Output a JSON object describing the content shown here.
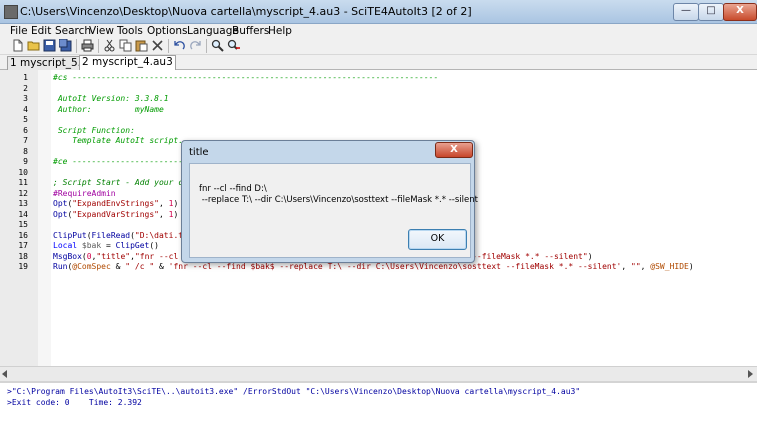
{
  "window": {
    "title": "C:\\Users\\Vincenzo\\Desktop\\Nuova cartella\\myscript_4.au3 - SciTE4AutoIt3 [2 of 2]",
    "minimize": "—",
    "maximize": "□",
    "close": "X",
    "icon": "scite-app-icon"
  },
  "menu": [
    "File",
    "Edit",
    "Search",
    "View",
    "Tools",
    "Options",
    "Language",
    "Buffers",
    "Help"
  ],
  "toolbar": {
    "icons": [
      "new-file-icon",
      "open-folder-icon",
      "save-icon",
      "save-all-icon",
      "print-icon",
      "cut-icon",
      "copy-icon",
      "paste-icon",
      "delete-icon",
      "undo-icon",
      "redo-icon",
      "find-icon",
      "find-replace-icon"
    ]
  },
  "tabs": [
    {
      "label": "1 myscript_5.au3",
      "active": false
    },
    {
      "label": "2 myscript_4.au3",
      "active": true
    }
  ],
  "editor": {
    "line_numbers": [
      "1",
      "2",
      "3",
      "4",
      "5",
      "6",
      "7",
      "8",
      "9",
      "10",
      "11",
      "12",
      "13",
      "14",
      "15",
      "16",
      "17",
      "18",
      "19"
    ],
    "lines": [
      [
        {
          "t": "#cs ----------------------------------------------------------------------------",
          "c": "c-blk"
        }
      ],
      [
        {
          "t": "",
          "c": "c-plain"
        }
      ],
      [
        {
          "t": " AutoIt Version: 3.3.8.1",
          "c": "c-blk"
        }
      ],
      [
        {
          "t": " Author:         myName",
          "c": "c-blk"
        }
      ],
      [
        {
          "t": "",
          "c": "c-plain"
        }
      ],
      [
        {
          "t": " Script Function:",
          "c": "c-blk"
        }
      ],
      [
        {
          "t": "    Template AutoIt script.",
          "c": "c-blk"
        }
      ],
      [
        {
          "t": "",
          "c": "c-plain"
        }
      ],
      [
        {
          "t": "#ce ----------------------------------------------------------------------------",
          "c": "c-blk"
        }
      ],
      [
        {
          "t": "",
          "c": "c-plain"
        }
      ],
      [
        {
          "t": "; Script Start - Add your code below here",
          "c": "c-com"
        }
      ],
      [
        {
          "t": "#RequireAdmin",
          "c": "c-dir"
        }
      ],
      [
        {
          "t": "Opt",
          "c": "c-fn"
        },
        {
          "t": "(",
          "c": "c-plain"
        },
        {
          "t": "\"ExpandEnvStrings\"",
          "c": "c-str"
        },
        {
          "t": ", ",
          "c": "c-plain"
        },
        {
          "t": "1",
          "c": "c-num"
        },
        {
          "t": ")",
          "c": "c-plain"
        }
      ],
      [
        {
          "t": "Opt",
          "c": "c-fn"
        },
        {
          "t": "(",
          "c": "c-plain"
        },
        {
          "t": "\"ExpandVarStrings\"",
          "c": "c-str"
        },
        {
          "t": ", ",
          "c": "c-plain"
        },
        {
          "t": "1",
          "c": "c-num"
        },
        {
          "t": ")",
          "c": "c-plain"
        }
      ],
      [
        {
          "t": "",
          "c": "c-plain"
        }
      ],
      [
        {
          "t": "ClipPut",
          "c": "c-fn"
        },
        {
          "t": "(",
          "c": "c-plain"
        },
        {
          "t": "FileRead",
          "c": "c-fn"
        },
        {
          "t": "(",
          "c": "c-plain"
        },
        {
          "t": "\"D:\\dati.txt\"",
          "c": "c-str"
        },
        {
          "t": "))",
          "c": "c-plain"
        }
      ],
      [
        {
          "t": "Local ",
          "c": "c-kw"
        },
        {
          "t": "$bak",
          "c": "c-var"
        },
        {
          "t": " = ",
          "c": "c-plain"
        },
        {
          "t": "ClipGet",
          "c": "c-fn"
        },
        {
          "t": "()",
          "c": "c-plain"
        }
      ],
      [
        {
          "t": "MsgBox",
          "c": "c-fn"
        },
        {
          "t": "(",
          "c": "c-plain"
        },
        {
          "t": "0",
          "c": "c-num"
        },
        {
          "t": ",",
          "c": "c-plain"
        },
        {
          "t": "\"title\"",
          "c": "c-str"
        },
        {
          "t": ",",
          "c": "c-plain"
        },
        {
          "t": "\"fnr --cl --find $bak$ --replace T:\\ --dir C:\\Users\\Vincenzo\\sosttext --fileMask *.* --silent\"",
          "c": "c-str"
        },
        {
          "t": ")",
          "c": "c-plain"
        }
      ],
      [
        {
          "t": "Run",
          "c": "c-fn"
        },
        {
          "t": "(",
          "c": "c-plain"
        },
        {
          "t": "@ComSpec",
          "c": "c-macro"
        },
        {
          "t": " & ",
          "c": "c-plain"
        },
        {
          "t": "\" /c \"",
          "c": "c-str"
        },
        {
          "t": " & ",
          "c": "c-plain"
        },
        {
          "t": "'fnr --cl --find $bak$ --replace T:\\ --dir C:\\Users\\Vincenzo\\sosttext --fileMask *.* --silent'",
          "c": "c-str"
        },
        {
          "t": ", ",
          "c": "c-plain"
        },
        {
          "t": "\"\"",
          "c": "c-str"
        },
        {
          "t": ", ",
          "c": "c-plain"
        },
        {
          "t": "@SW_HIDE",
          "c": "c-macro"
        },
        {
          "t": ")",
          "c": "c-plain"
        }
      ]
    ]
  },
  "output": {
    "line1": ">\"C:\\Program Files\\AutoIt3\\SciTE\\..\\autoit3.exe\" /ErrorStdOut \"C:\\Users\\Vincenzo\\Desktop\\Nuova cartella\\myscript_4.au3\"",
    "line2": ">Exit code: 0    Time: 2.392"
  },
  "dialog": {
    "title": "title",
    "close": "X",
    "message_line1": "fnr --cl --find D:\\",
    "message_line2": " --replace T:\\ --dir C:\\Users\\Vincenzo\\sosttext --fileMask *.* --silent",
    "ok_label": "OK"
  }
}
